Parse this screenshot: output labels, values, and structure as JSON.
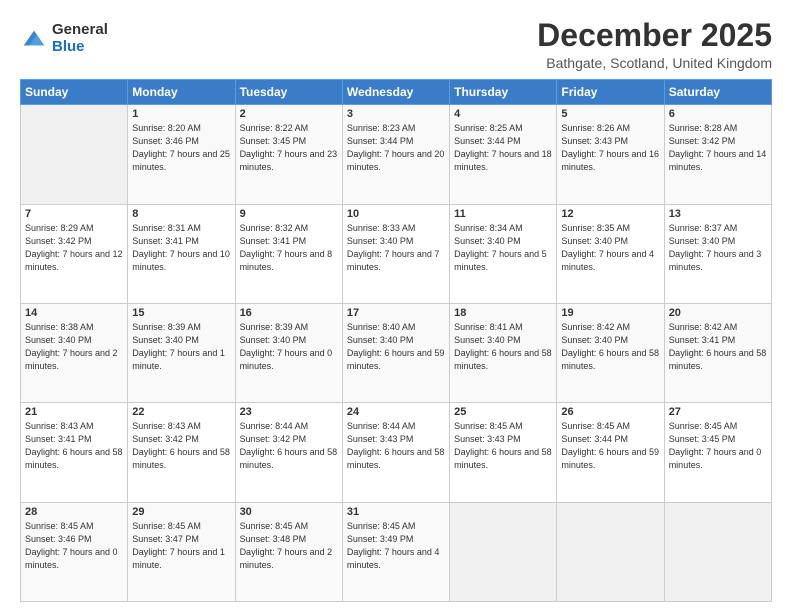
{
  "logo": {
    "general": "General",
    "blue": "Blue"
  },
  "title": "December 2025",
  "subtitle": "Bathgate, Scotland, United Kingdom",
  "header_days": [
    "Sunday",
    "Monday",
    "Tuesday",
    "Wednesday",
    "Thursday",
    "Friday",
    "Saturday"
  ],
  "weeks": [
    [
      {
        "day": "",
        "sunrise": "",
        "sunset": "",
        "daylight": ""
      },
      {
        "day": "1",
        "sunrise": "Sunrise: 8:20 AM",
        "sunset": "Sunset: 3:46 PM",
        "daylight": "Daylight: 7 hours and 25 minutes."
      },
      {
        "day": "2",
        "sunrise": "Sunrise: 8:22 AM",
        "sunset": "Sunset: 3:45 PM",
        "daylight": "Daylight: 7 hours and 23 minutes."
      },
      {
        "day": "3",
        "sunrise": "Sunrise: 8:23 AM",
        "sunset": "Sunset: 3:44 PM",
        "daylight": "Daylight: 7 hours and 20 minutes."
      },
      {
        "day": "4",
        "sunrise": "Sunrise: 8:25 AM",
        "sunset": "Sunset: 3:44 PM",
        "daylight": "Daylight: 7 hours and 18 minutes."
      },
      {
        "day": "5",
        "sunrise": "Sunrise: 8:26 AM",
        "sunset": "Sunset: 3:43 PM",
        "daylight": "Daylight: 7 hours and 16 minutes."
      },
      {
        "day": "6",
        "sunrise": "Sunrise: 8:28 AM",
        "sunset": "Sunset: 3:42 PM",
        "daylight": "Daylight: 7 hours and 14 minutes."
      }
    ],
    [
      {
        "day": "7",
        "sunrise": "Sunrise: 8:29 AM",
        "sunset": "Sunset: 3:42 PM",
        "daylight": "Daylight: 7 hours and 12 minutes."
      },
      {
        "day": "8",
        "sunrise": "Sunrise: 8:31 AM",
        "sunset": "Sunset: 3:41 PM",
        "daylight": "Daylight: 7 hours and 10 minutes."
      },
      {
        "day": "9",
        "sunrise": "Sunrise: 8:32 AM",
        "sunset": "Sunset: 3:41 PM",
        "daylight": "Daylight: 7 hours and 8 minutes."
      },
      {
        "day": "10",
        "sunrise": "Sunrise: 8:33 AM",
        "sunset": "Sunset: 3:40 PM",
        "daylight": "Daylight: 7 hours and 7 minutes."
      },
      {
        "day": "11",
        "sunrise": "Sunrise: 8:34 AM",
        "sunset": "Sunset: 3:40 PM",
        "daylight": "Daylight: 7 hours and 5 minutes."
      },
      {
        "day": "12",
        "sunrise": "Sunrise: 8:35 AM",
        "sunset": "Sunset: 3:40 PM",
        "daylight": "Daylight: 7 hours and 4 minutes."
      },
      {
        "day": "13",
        "sunrise": "Sunrise: 8:37 AM",
        "sunset": "Sunset: 3:40 PM",
        "daylight": "Daylight: 7 hours and 3 minutes."
      }
    ],
    [
      {
        "day": "14",
        "sunrise": "Sunrise: 8:38 AM",
        "sunset": "Sunset: 3:40 PM",
        "daylight": "Daylight: 7 hours and 2 minutes."
      },
      {
        "day": "15",
        "sunrise": "Sunrise: 8:39 AM",
        "sunset": "Sunset: 3:40 PM",
        "daylight": "Daylight: 7 hours and 1 minute."
      },
      {
        "day": "16",
        "sunrise": "Sunrise: 8:39 AM",
        "sunset": "Sunset: 3:40 PM",
        "daylight": "Daylight: 7 hours and 0 minutes."
      },
      {
        "day": "17",
        "sunrise": "Sunrise: 8:40 AM",
        "sunset": "Sunset: 3:40 PM",
        "daylight": "Daylight: 6 hours and 59 minutes."
      },
      {
        "day": "18",
        "sunrise": "Sunrise: 8:41 AM",
        "sunset": "Sunset: 3:40 PM",
        "daylight": "Daylight: 6 hours and 58 minutes."
      },
      {
        "day": "19",
        "sunrise": "Sunrise: 8:42 AM",
        "sunset": "Sunset: 3:40 PM",
        "daylight": "Daylight: 6 hours and 58 minutes."
      },
      {
        "day": "20",
        "sunrise": "Sunrise: 8:42 AM",
        "sunset": "Sunset: 3:41 PM",
        "daylight": "Daylight: 6 hours and 58 minutes."
      }
    ],
    [
      {
        "day": "21",
        "sunrise": "Sunrise: 8:43 AM",
        "sunset": "Sunset: 3:41 PM",
        "daylight": "Daylight: 6 hours and 58 minutes."
      },
      {
        "day": "22",
        "sunrise": "Sunrise: 8:43 AM",
        "sunset": "Sunset: 3:42 PM",
        "daylight": "Daylight: 6 hours and 58 minutes."
      },
      {
        "day": "23",
        "sunrise": "Sunrise: 8:44 AM",
        "sunset": "Sunset: 3:42 PM",
        "daylight": "Daylight: 6 hours and 58 minutes."
      },
      {
        "day": "24",
        "sunrise": "Sunrise: 8:44 AM",
        "sunset": "Sunset: 3:43 PM",
        "daylight": "Daylight: 6 hours and 58 minutes."
      },
      {
        "day": "25",
        "sunrise": "Sunrise: 8:45 AM",
        "sunset": "Sunset: 3:43 PM",
        "daylight": "Daylight: 6 hours and 58 minutes."
      },
      {
        "day": "26",
        "sunrise": "Sunrise: 8:45 AM",
        "sunset": "Sunset: 3:44 PM",
        "daylight": "Daylight: 6 hours and 59 minutes."
      },
      {
        "day": "27",
        "sunrise": "Sunrise: 8:45 AM",
        "sunset": "Sunset: 3:45 PM",
        "daylight": "Daylight: 7 hours and 0 minutes."
      }
    ],
    [
      {
        "day": "28",
        "sunrise": "Sunrise: 8:45 AM",
        "sunset": "Sunset: 3:46 PM",
        "daylight": "Daylight: 7 hours and 0 minutes."
      },
      {
        "day": "29",
        "sunrise": "Sunrise: 8:45 AM",
        "sunset": "Sunset: 3:47 PM",
        "daylight": "Daylight: 7 hours and 1 minute."
      },
      {
        "day": "30",
        "sunrise": "Sunrise: 8:45 AM",
        "sunset": "Sunset: 3:48 PM",
        "daylight": "Daylight: 7 hours and 2 minutes."
      },
      {
        "day": "31",
        "sunrise": "Sunrise: 8:45 AM",
        "sunset": "Sunset: 3:49 PM",
        "daylight": "Daylight: 7 hours and 4 minutes."
      },
      {
        "day": "",
        "sunrise": "",
        "sunset": "",
        "daylight": ""
      },
      {
        "day": "",
        "sunrise": "",
        "sunset": "",
        "daylight": ""
      },
      {
        "day": "",
        "sunrise": "",
        "sunset": "",
        "daylight": ""
      }
    ]
  ]
}
